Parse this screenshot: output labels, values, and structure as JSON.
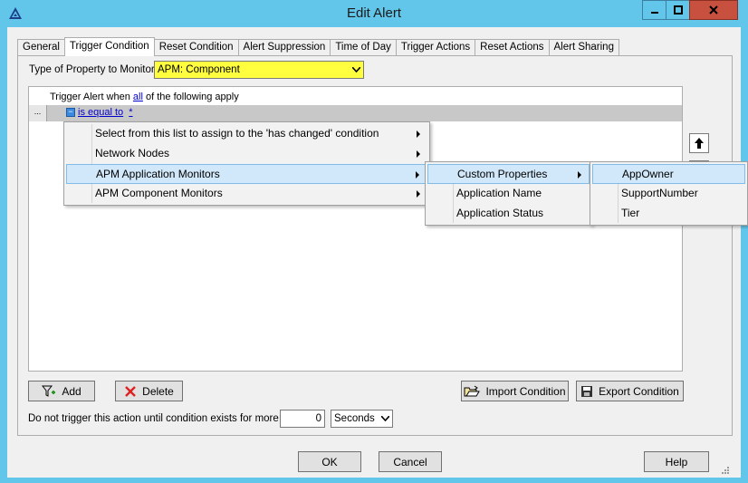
{
  "window": {
    "title": "Edit Alert",
    "controls": {
      "minimize": "minimize-icon",
      "maximize": "maximize-icon",
      "close": "close-icon"
    }
  },
  "tabs": [
    {
      "label": "General",
      "active": false
    },
    {
      "label": "Trigger Condition",
      "active": true
    },
    {
      "label": "Reset Condition",
      "active": false
    },
    {
      "label": "Alert Suppression",
      "active": false
    },
    {
      "label": "Time of Day",
      "active": false
    },
    {
      "label": "Trigger Actions",
      "active": false
    },
    {
      "label": "Reset Actions",
      "active": false
    },
    {
      "label": "Alert Sharing",
      "active": false
    }
  ],
  "property": {
    "label": "Type of Property to Monitor:",
    "value": "APM: Component",
    "highlight_color": "#ffff40"
  },
  "condition": {
    "header_prefix": "Trigger Alert when",
    "header_link": "all",
    "header_suffix": "of the following apply",
    "row_ellipsis": "...",
    "row_link": "is equal to",
    "row_value": "*"
  },
  "context_menu": {
    "items": [
      {
        "label": "Select from this list to assign to the 'has changed' condition",
        "has_submenu": true,
        "highlighted": false
      },
      {
        "label": "Network Nodes",
        "has_submenu": true,
        "highlighted": false
      },
      {
        "label": "APM Application Monitors",
        "has_submenu": true,
        "highlighted": true
      },
      {
        "label": "APM Component Monitors",
        "has_submenu": true,
        "highlighted": false
      }
    ]
  },
  "submenu_app": {
    "items": [
      {
        "label": "Custom Properties",
        "has_submenu": true,
        "highlighted": true
      },
      {
        "label": "Application Name",
        "has_submenu": false,
        "highlighted": false
      },
      {
        "label": "Application Status",
        "has_submenu": false,
        "highlighted": false
      }
    ]
  },
  "submenu_custom": {
    "items": [
      {
        "label": "AppOwner",
        "highlighted": true
      },
      {
        "label": "SupportNumber",
        "highlighted": false
      },
      {
        "label": "Tier",
        "highlighted": false
      }
    ]
  },
  "buttons": {
    "add": "Add",
    "delete": "Delete",
    "import": "Import Condition",
    "export": "Export Condition",
    "ok": "OK",
    "cancel": "Cancel",
    "help": "Help"
  },
  "duration": {
    "label": "Do not trigger this action until condition exists for more than",
    "value": "0",
    "unit": "Seconds"
  },
  "colors": {
    "titlebar": "#62c6ea",
    "close_button": "#c7503f",
    "menu_highlight": "#d1e8fa",
    "link": "#0000cc"
  }
}
